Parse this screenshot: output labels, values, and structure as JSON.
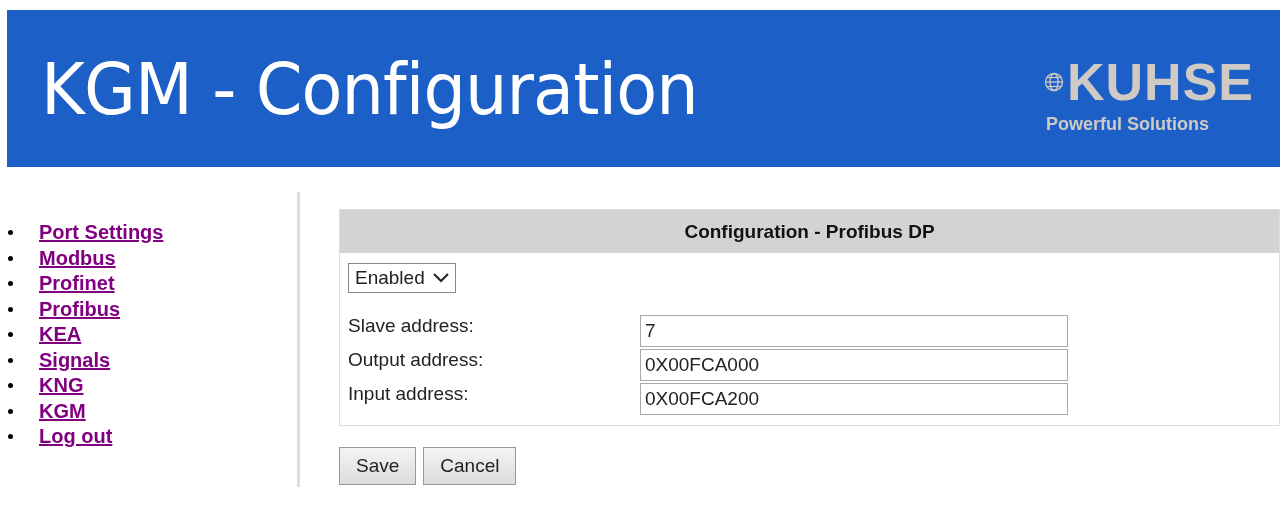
{
  "header": {
    "title": "KGM - Configuration",
    "logo": {
      "name": "KUHSE",
      "tagline": "Powerful Solutions"
    }
  },
  "sidebar": {
    "items": [
      {
        "label": "Port Settings"
      },
      {
        "label": "Modbus"
      },
      {
        "label": "Profinet"
      },
      {
        "label": "Profibus"
      },
      {
        "label": "KEA"
      },
      {
        "label": "Signals"
      },
      {
        "label": "KNG"
      },
      {
        "label": "KGM"
      },
      {
        "label": "Log out"
      }
    ]
  },
  "panel": {
    "title": "Configuration - Profibus DP",
    "mode": "Enabled",
    "fields": [
      {
        "label": "Slave address:",
        "value": "7"
      },
      {
        "label": "Output address:",
        "value": "0X00FCA000"
      },
      {
        "label": "Input address:",
        "value": "0X00FCA200"
      }
    ]
  },
  "buttons": [
    "Save",
    "Cancel"
  ]
}
